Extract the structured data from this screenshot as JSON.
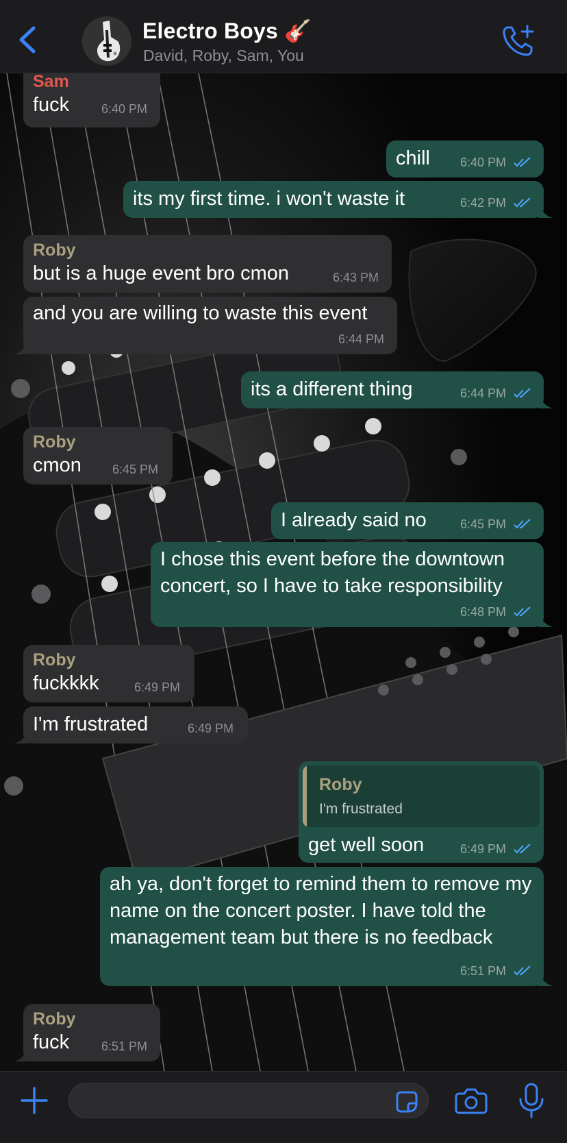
{
  "header": {
    "title": "Electro Boys 🎸",
    "members": "David, Roby, Sam, You"
  },
  "colors": {
    "accent": "#3b82f6",
    "outgoing_bubble": "#215146",
    "incoming_bubble": "#2f2f31",
    "sender_sam": "#e2574c",
    "sender_roby": "#a9a07e",
    "read_check": "#4fa8ff"
  },
  "messages": [
    {
      "id": "m1",
      "dir": "in",
      "sender": "Sam",
      "text": "fuck",
      "time": "6:40 PM"
    },
    {
      "id": "m2",
      "dir": "out",
      "text": "chill",
      "time": "6:40 PM",
      "status": "read"
    },
    {
      "id": "m3",
      "dir": "out",
      "text": "its my first time. i won't waste it",
      "time": "6:42 PM",
      "status": "read"
    },
    {
      "id": "m4",
      "dir": "in",
      "sender": "Roby",
      "text": "but is a huge event bro cmon",
      "time": "6:43 PM"
    },
    {
      "id": "m5",
      "dir": "in",
      "text": "and you are willing to waste this event",
      "time": "6:44 PM"
    },
    {
      "id": "m6",
      "dir": "out",
      "text": "its a different thing",
      "time": "6:44 PM",
      "status": "read"
    },
    {
      "id": "m7",
      "dir": "in",
      "sender": "Roby",
      "text": "cmon",
      "time": "6:45 PM"
    },
    {
      "id": "m8",
      "dir": "out",
      "text": "I already said no",
      "time": "6:45 PM",
      "status": "read"
    },
    {
      "id": "m9",
      "dir": "out",
      "text": "I chose this event before the downtown concert, so I have to take responsibility",
      "time": "6:48 PM",
      "status": "read"
    },
    {
      "id": "m10",
      "dir": "in",
      "sender": "Roby",
      "text": "fuckkkk",
      "time": "6:49 PM"
    },
    {
      "id": "m11",
      "dir": "in",
      "text": "I'm frustrated",
      "time": "6:49 PM"
    },
    {
      "id": "m12",
      "dir": "out",
      "reply_to": {
        "sender": "Roby",
        "text": "I'm frustrated"
      },
      "text": "get well soon",
      "time": "6:49 PM",
      "status": "read"
    },
    {
      "id": "m13",
      "dir": "out",
      "text": "ah ya, don't forget to remind them to remove my name on the concert poster. I have told the management team but there is no feedback",
      "time": "6:51 PM",
      "status": "read"
    },
    {
      "id": "m14",
      "dir": "in",
      "sender": "Roby",
      "text": "fuck",
      "time": "6:51 PM"
    }
  ],
  "composer": {
    "value": "",
    "placeholder": ""
  }
}
